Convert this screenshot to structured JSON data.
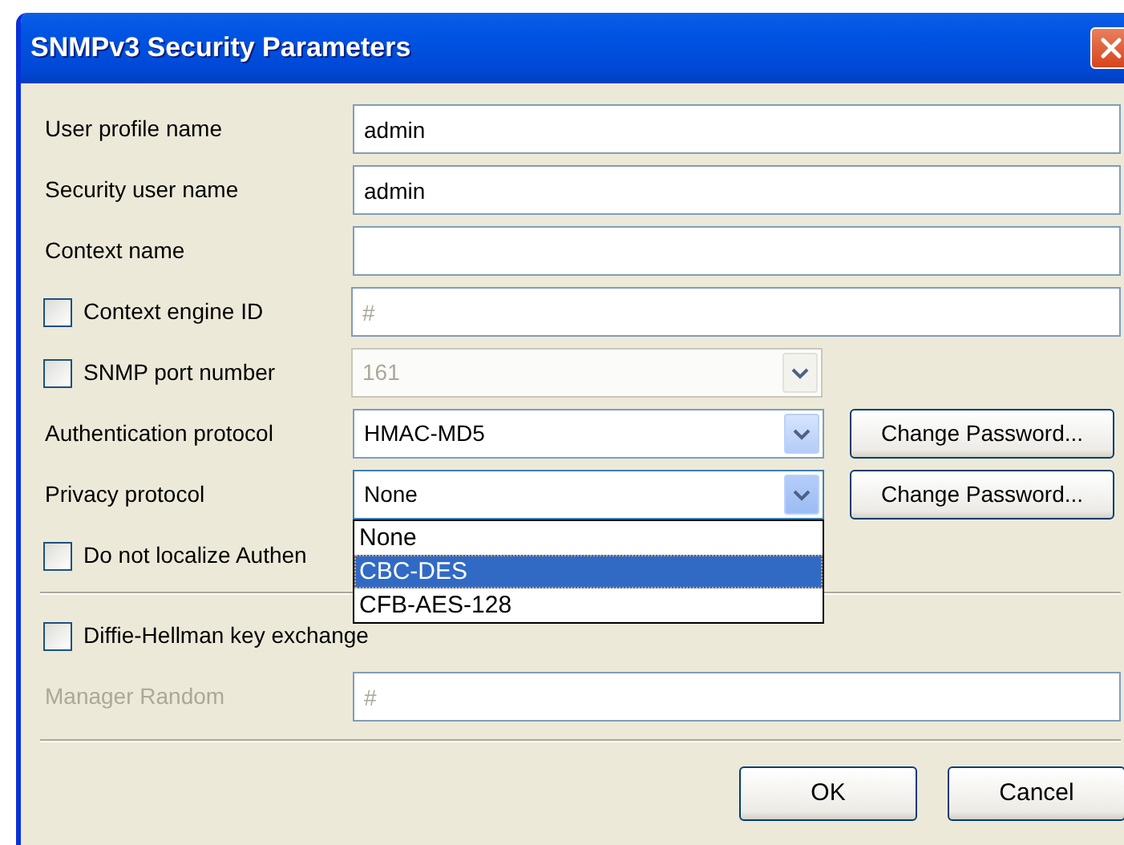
{
  "window": {
    "title": "SNMPv3 Security Parameters"
  },
  "fields": [
    {
      "kind": "text",
      "label": "User profile name",
      "value": "admin"
    },
    {
      "kind": "text",
      "label": "Security user name",
      "value": "admin"
    },
    {
      "kind": "text",
      "label": "Context name"
    },
    {
      "kind": "check_text",
      "label": "Context engine ID",
      "checked": false,
      "placeholder": "#"
    },
    {
      "kind": "check_combo",
      "label": "SNMP port number",
      "checked": false,
      "value": "161",
      "disabled": true
    },
    {
      "kind": "combo_button",
      "label": "Authentication protocol",
      "value": "HMAC-MD5",
      "button": "Change Password..."
    },
    {
      "kind": "combo_button",
      "label": "Privacy protocol",
      "value": "None",
      "button": "Change Password...",
      "expanded": true,
      "options": [
        {
          "label": "None",
          "highlighted": false
        },
        {
          "label": "CBC-DES",
          "highlighted": true
        },
        {
          "label": "CFB-AES-128",
          "highlighted": false
        }
      ]
    },
    {
      "kind": "checkbox",
      "label": "Do not localize Authen",
      "checked": false
    },
    {
      "kind": "separator"
    },
    {
      "kind": "checkbox",
      "label": "Diffie-Hellman key exchange",
      "checked": false
    },
    {
      "kind": "text",
      "label": "Manager Random",
      "placeholder": "#",
      "disabled": true
    },
    {
      "kind": "separator"
    }
  ],
  "buttons": [
    {
      "label": "OK"
    },
    {
      "label": "Cancel"
    }
  ]
}
